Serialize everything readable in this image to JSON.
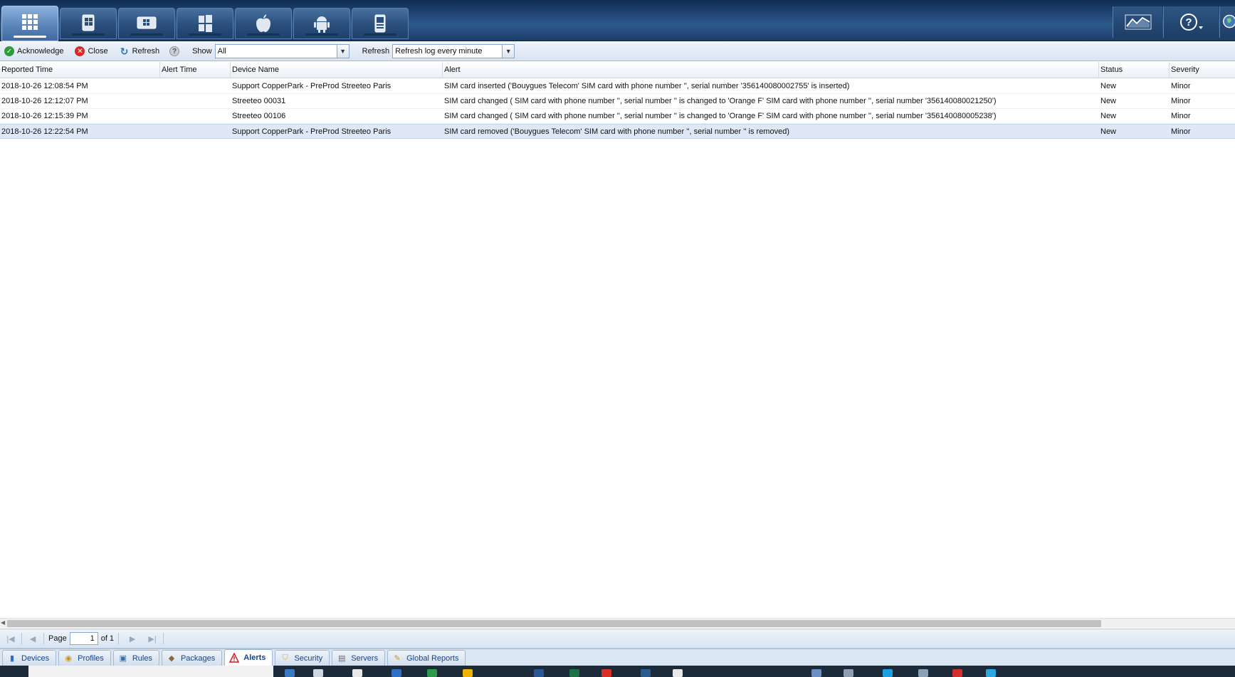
{
  "nav": {
    "tabs": [
      {
        "icon": "all-devices-grid-icon",
        "active": true
      },
      {
        "icon": "windows-mobile-icon",
        "active": false
      },
      {
        "icon": "windows-ce-icon",
        "active": false
      },
      {
        "icon": "windows-icon",
        "active": false
      },
      {
        "icon": "apple-icon",
        "active": false
      },
      {
        "icon": "android-icon",
        "active": false
      },
      {
        "icon": "printer-device-icon",
        "active": false
      }
    ],
    "right": [
      {
        "icon": "monitoring-chart-icon"
      },
      {
        "icon": "help-icon"
      },
      {
        "icon": "globe-icon"
      }
    ]
  },
  "toolbar": {
    "acknowledge_label": "Acknowledge",
    "close_label": "Close",
    "refresh_label": "Refresh",
    "show_label": "Show",
    "show_value": "All",
    "refresh_select_label": "Refresh",
    "refresh_select_value": "Refresh log every minute"
  },
  "grid": {
    "columns": [
      "Reported Time",
      "Alert Time",
      "Device Name",
      "Alert",
      "Status",
      "Severity"
    ],
    "rows": [
      {
        "reported_time": "2018-10-26 12:08:54 PM",
        "alert_time": "",
        "device": "Support CopperPark - PreProd Streeteo Paris",
        "alert": "SIM card inserted ('Bouygues Telecom' SIM card with phone number '', serial number '356140080002755' is inserted)",
        "status": "New",
        "severity": "Minor",
        "selected": false
      },
      {
        "reported_time": "2018-10-26 12:12:07 PM",
        "alert_time": "",
        "device": "Streeteo 00031",
        "alert": "SIM card changed ( SIM card with phone number '', serial number '' is changed to 'Orange F' SIM card with phone number '', serial number '356140080021250')",
        "status": "New",
        "severity": "Minor",
        "selected": false
      },
      {
        "reported_time": "2018-10-26 12:15:39 PM",
        "alert_time": "",
        "device": "Streeteo 00106",
        "alert": "SIM card changed ( SIM card with phone number '', serial number '' is changed to 'Orange F' SIM card with phone number '', serial number '356140080005238')",
        "status": "New",
        "severity": "Minor",
        "selected": false
      },
      {
        "reported_time": "2018-10-26 12:22:54 PM",
        "alert_time": "",
        "device": "Support CopperPark - PreProd Streeteo Paris",
        "alert": "SIM card removed ('Bouygues Telecom' SIM card with phone number '', serial number '' is removed)",
        "status": "New",
        "severity": "Minor",
        "selected": true
      }
    ]
  },
  "pager": {
    "page_label": "Page",
    "page_value": "1",
    "of_label": "of 1"
  },
  "bottom_tabs": [
    {
      "label": "Devices",
      "icon": "devices-icon",
      "active": false
    },
    {
      "label": "Profiles",
      "icon": "profiles-icon",
      "active": false
    },
    {
      "label": "Rules",
      "icon": "rules-icon",
      "active": false
    },
    {
      "label": "Packages",
      "icon": "packages-icon",
      "active": false
    },
    {
      "label": "Alerts",
      "icon": "alert-warning-icon",
      "active": true
    },
    {
      "label": "Security",
      "icon": "security-shield-icon",
      "active": false
    },
    {
      "label": "Servers",
      "icon": "servers-icon",
      "active": false
    },
    {
      "label": "Global Reports",
      "icon": "global-reports-icon",
      "active": false
    }
  ],
  "colors": {
    "nav_dark": "#1b3d68",
    "acknowledge_green": "#2e9b3a",
    "close_red": "#d62b2b",
    "refresh_blue": "#2d6fc0",
    "selected_row": "#dfe8f6",
    "tab_text": "#15428b"
  }
}
